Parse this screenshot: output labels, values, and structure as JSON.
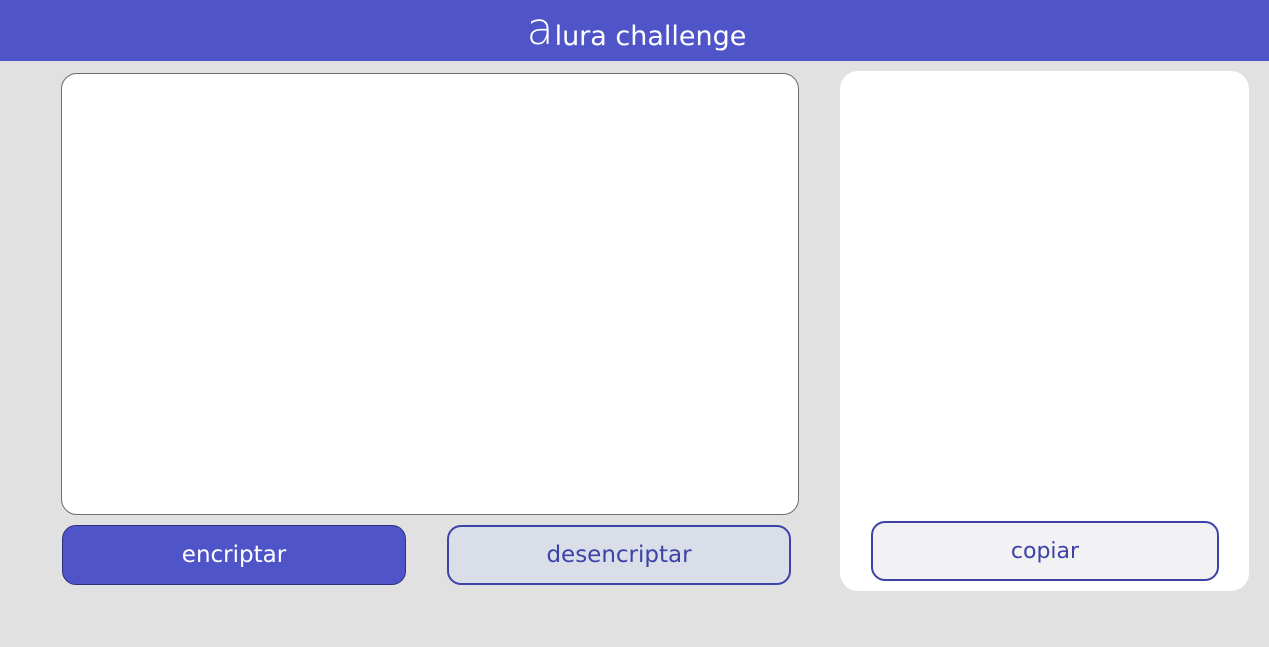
{
  "header": {
    "logo_letter": "a",
    "logo_text": "lura challenge"
  },
  "input": {
    "value": "",
    "placeholder": ""
  },
  "buttons": {
    "encrypt_label": "encriptar",
    "decrypt_label": "desencriptar",
    "copy_label": "copiar"
  },
  "output": {
    "text": ""
  },
  "colors": {
    "brand": "#4f55c9",
    "page_background": "#e1e1e1",
    "secondary_button_fill": "#d9dee8",
    "accent_text": "#3c42a8"
  }
}
